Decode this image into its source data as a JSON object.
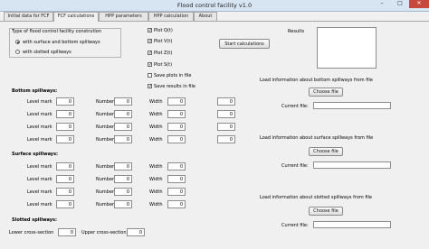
{
  "window": {
    "title": "Flood control facility v1.0",
    "minimize": "–",
    "maximize": "□",
    "close": "✕"
  },
  "tabs": [
    {
      "label": "Initial data for FCF"
    },
    {
      "label": "FCF calculations"
    },
    {
      "label": "HPP parameters"
    },
    {
      "label": "HPP calculation"
    },
    {
      "label": "About"
    }
  ],
  "construction": {
    "title": "Type of flood control facility constrution",
    "options": [
      "with surface and bottom spillways",
      "with slotted spillways"
    ],
    "selected": 0
  },
  "plots": {
    "items": [
      {
        "label": "Plot Q(t)",
        "checked": true
      },
      {
        "label": "Plot V(t)",
        "checked": true
      },
      {
        "label": "Plot Z(t)",
        "checked": true
      },
      {
        "label": "Plot S(t)",
        "checked": true
      },
      {
        "label": "Save plots in file",
        "checked": false
      },
      {
        "label": "Save results in file",
        "checked": true
      }
    ],
    "check_mark": "✓"
  },
  "start_button": "Start calculations",
  "results_label": "Results",
  "labels": {
    "level_mark": "Level mark",
    "number": "Number",
    "width": "Width"
  },
  "bottom": {
    "title": "Bottom spillways:"
  },
  "surface": {
    "title": "Surface spillways:"
  },
  "slotted": {
    "title": "Slotted spillways:",
    "lower": "Lower cross-section",
    "upper": "Upper cross-section",
    "lower_value": "0",
    "upper_value": "0"
  },
  "load": {
    "bottom_title": "Load information about bottom spillways from file",
    "surface_title": "Load information about surface spillways from file",
    "slotted_title": "Load information about slotted spillways from file",
    "choose": "Choose file",
    "current": "Current file:"
  },
  "zero": "0"
}
